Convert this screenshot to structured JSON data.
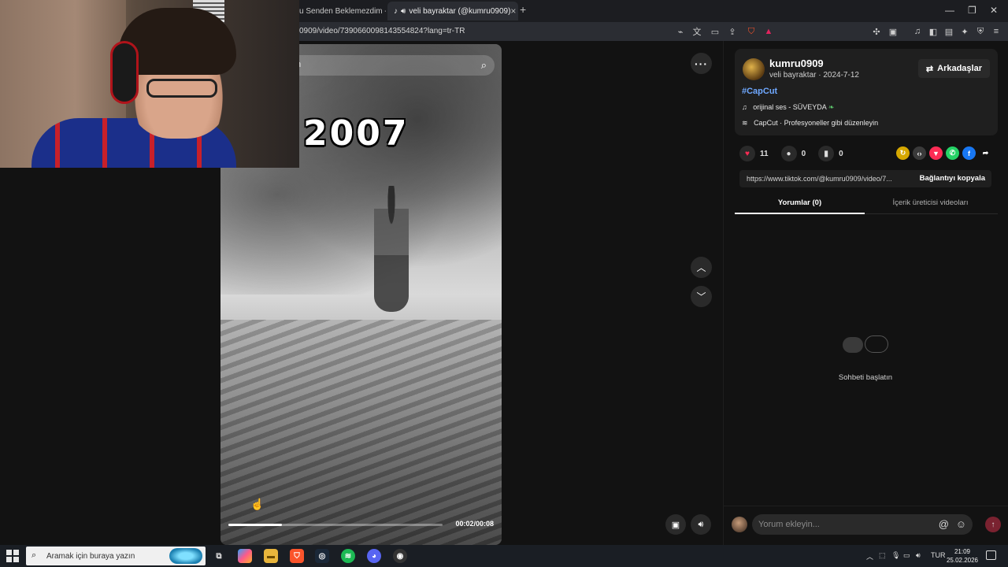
{
  "browser": {
    "tabs": [
      {
        "label": "u Senden Beklemezdim - You"
      },
      {
        "label": "veli bayraktar (@kumru0909)"
      }
    ],
    "url": "0909/video/7390660098143554824?lang=tr-TR"
  },
  "video": {
    "caption": "2007",
    "search_placeholder": "n",
    "progress": 0.25,
    "time": "00:02/00:08"
  },
  "post": {
    "username": "kumru0909",
    "display_name": "veli bayraktar",
    "date": "2024-7-12",
    "friends_button": "Arkadaşlar",
    "hashtag": "#CapCut",
    "music": "orijinal ses - SÜVEYDA",
    "capcut": "CapCut · Profesyoneller gibi düzenleyin",
    "likes": "11",
    "comments": "0",
    "saves": "0",
    "link": "https://www.tiktok.com/@kumru0909/video/7...",
    "copy_link": "Bağlantıyı kopyala"
  },
  "panel_tabs": {
    "comments": "Yorumlar (0)",
    "creator_videos": "İçerik üreticisi videoları"
  },
  "empty_state": "Sohbeti başlatın",
  "comment_input_placeholder": "Yorum ekleyin...",
  "taskbar": {
    "search_placeholder": "Aramak için buraya yazın",
    "language": "TUR",
    "time": "21:09",
    "date": "25.02.2026"
  },
  "colors": {
    "accent_like": "#fe2c55",
    "hashtag": "#6fa8ff",
    "background": "#121212"
  }
}
